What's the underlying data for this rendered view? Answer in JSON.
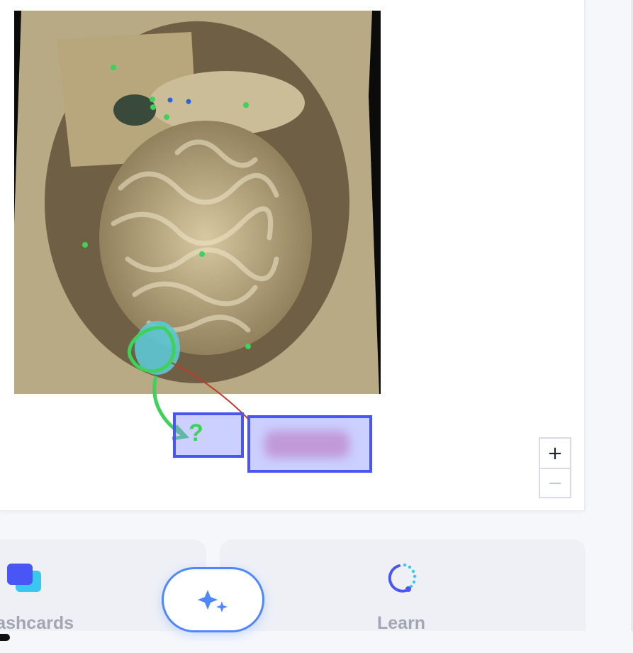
{
  "diagram": {
    "hotspot_left_label": "?",
    "hotspot_right_label": ""
  },
  "zoom": {
    "in_label": "+",
    "out_label": "−"
  },
  "modes": {
    "flashcards_label": "Flashcards",
    "learn_label": "Learn"
  },
  "colors": {
    "accent_blue": "#4a55f5",
    "fab_border": "#4e87ff",
    "annotation_green": "#3fd15a",
    "leader_red": "#c0392b",
    "highlight_cyan": "#5cc8d6"
  },
  "icons": {
    "flashcards": "flashcards-icon",
    "learn": "learn-icon",
    "ai_assist": "sparkle-icon"
  }
}
